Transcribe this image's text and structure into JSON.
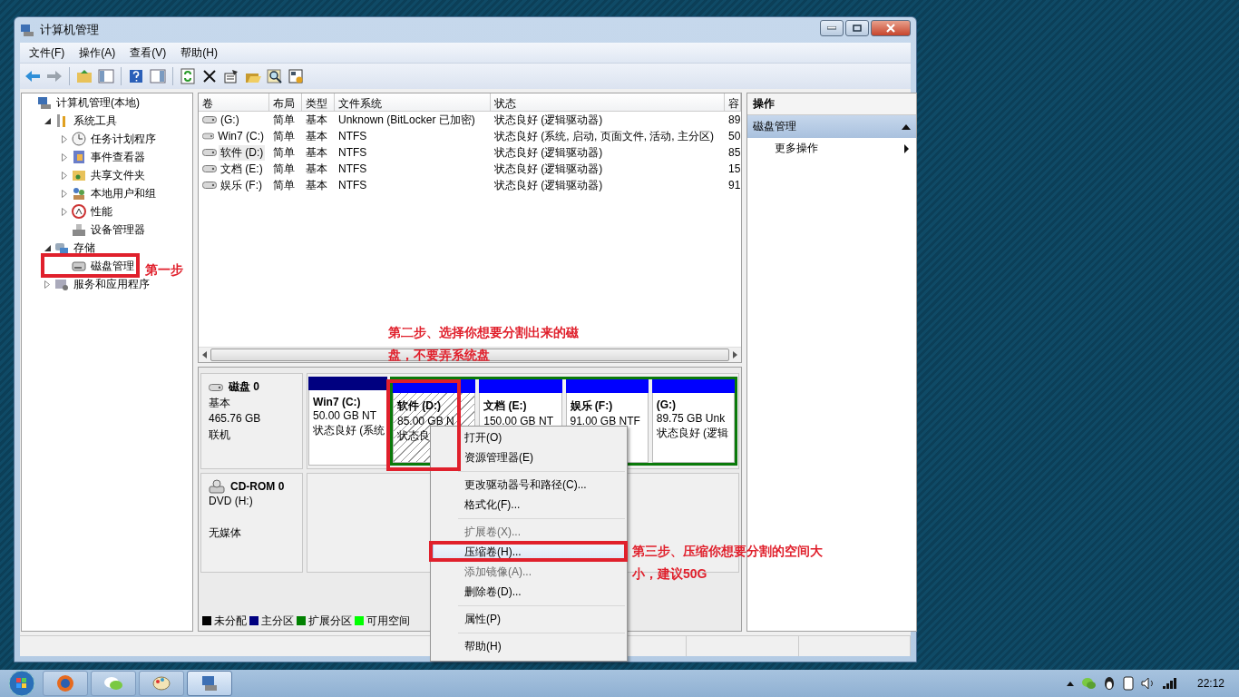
{
  "window": {
    "title": "计算机管理"
  },
  "menu": [
    "文件(F)",
    "操作(A)",
    "查看(V)",
    "帮助(H)"
  ],
  "tree": [
    {
      "label": "计算机管理(本地)",
      "kind": "computer",
      "children": [
        {
          "label": "系统工具",
          "kind": "tools",
          "expanded": true,
          "children": [
            {
              "label": "任务计划程序",
              "kind": "clock",
              "expanded": false
            },
            {
              "label": "事件查看器",
              "kind": "log",
              "expanded": false
            },
            {
              "label": "共享文件夹",
              "kind": "folder",
              "expanded": false
            },
            {
              "label": "本地用户和组",
              "kind": "users",
              "expanded": false
            },
            {
              "label": "性能",
              "kind": "gauge",
              "expanded": false
            },
            {
              "label": "设备管理器",
              "kind": "device"
            }
          ]
        },
        {
          "label": "存储",
          "kind": "storage",
          "expanded": true,
          "children": [
            {
              "label": "磁盘管理",
              "kind": "disk"
            }
          ]
        },
        {
          "label": "服务和应用程序",
          "kind": "services",
          "expanded": false
        }
      ]
    }
  ],
  "table": {
    "columns": [
      "卷",
      "布局",
      "类型",
      "文件系统",
      "状态",
      "容"
    ],
    "rows": [
      {
        "cells": [
          "(G:)",
          "简单",
          "基本",
          "Unknown (BitLocker 已加密)",
          "状态良好 (逻辑驱动器)",
          "89"
        ],
        "selected": false
      },
      {
        "cells": [
          "Win7 (C:)",
          "简单",
          "基本",
          "NTFS",
          "状态良好 (系统, 启动, 页面文件, 活动, 主分区)",
          "50"
        ],
        "selected": false
      },
      {
        "cells": [
          "软件 (D:)",
          "简单",
          "基本",
          "NTFS",
          "状态良好 (逻辑驱动器)",
          "85"
        ],
        "selected": true
      },
      {
        "cells": [
          "文档 (E:)",
          "简单",
          "基本",
          "NTFS",
          "状态良好 (逻辑驱动器)",
          "15"
        ],
        "selected": false
      },
      {
        "cells": [
          "娱乐 (F:)",
          "简单",
          "基本",
          "NTFS",
          "状态良好 (逻辑驱动器)",
          "91"
        ],
        "selected": false
      }
    ]
  },
  "disks": [
    {
      "name": "磁盘 0",
      "kind": "hdd",
      "type": "基本",
      "size": "465.76 GB",
      "state": "联机",
      "partitions": [
        {
          "label": "Win7  (C:)",
          "size": "50.00 GB NT",
          "status": "状态良好 (系统",
          "kind": "primary",
          "selected": false
        },
        {
          "kind": "extended",
          "partitions": [
            {
              "label": "软件  (D:)",
              "size": "85.00 GB N",
              "status": "状态良",
              "kind": "logical",
              "selected": true
            },
            {
              "label": "文档  (E:)",
              "size": "150.00 GB NT",
              "kind": "logical",
              "selected": false
            },
            {
              "label": "娱乐  (F:)",
              "size": "91.00 GB NTF",
              "kind": "logical",
              "selected": false
            },
            {
              "label": "(G:)",
              "size": "89.75 GB Unk",
              "status": "状态良好 (逻辑",
              "kind": "logical",
              "selected": false
            }
          ]
        }
      ]
    },
    {
      "name": "CD-ROM 0",
      "kind": "cdrom",
      "type": "DVD (H:)",
      "state": "无媒体"
    }
  ],
  "legend": [
    {
      "label": "未分配",
      "color": "#000000"
    },
    {
      "label": "主分区",
      "color": "#000080"
    },
    {
      "label": "扩展分区",
      "color": "#008000"
    },
    {
      "label": "可用空间",
      "color": "#00ff00"
    }
  ],
  "actions": {
    "title": "操作",
    "section": "磁盘管理",
    "items": [
      "更多操作"
    ]
  },
  "context_menu": {
    "groups": [
      {
        "items": [
          {
            "label": "打开(O)",
            "disabled": false,
            "selected": false
          },
          {
            "label": "资源管理器(E)",
            "disabled": false,
            "selected": false
          }
        ]
      },
      {
        "items": [
          {
            "label": "更改驱动器号和路径(C)...",
            "disabled": false,
            "selected": false
          },
          {
            "label": "格式化(F)...",
            "disabled": false,
            "selected": false
          }
        ]
      },
      {
        "items": [
          {
            "label": "扩展卷(X)...",
            "disabled": true,
            "selected": false
          },
          {
            "label": "压缩卷(H)...",
            "disabled": false,
            "selected": true
          },
          {
            "label": "添加镜像(A)...",
            "disabled": true,
            "selected": false
          },
          {
            "label": "删除卷(D)...",
            "disabled": false,
            "selected": false
          }
        ]
      },
      {
        "items": [
          {
            "label": "属性(P)",
            "disabled": false,
            "selected": false
          }
        ]
      },
      {
        "items": [
          {
            "label": "帮助(H)",
            "disabled": false,
            "selected": false
          }
        ]
      }
    ]
  },
  "annotations": [
    {
      "kind": "box"
    },
    {
      "kind": "note",
      "text": "第一步"
    },
    {
      "kind": "note",
      "text": "第二步、选择你想要分割出来的磁盘，不要弄系统盘"
    },
    {
      "kind": "box"
    },
    {
      "kind": "box"
    },
    {
      "kind": "note",
      "text": "第三步、压缩你想要分割的空间大小，建议50G"
    }
  ],
  "taskbar": {
    "apps": [
      {
        "kind": "browser",
        "active": false
      },
      {
        "kind": "chat",
        "active": false
      },
      {
        "kind": "paint",
        "active": false
      },
      {
        "kind": "computer",
        "active": true
      }
    ],
    "time": "22:12"
  }
}
